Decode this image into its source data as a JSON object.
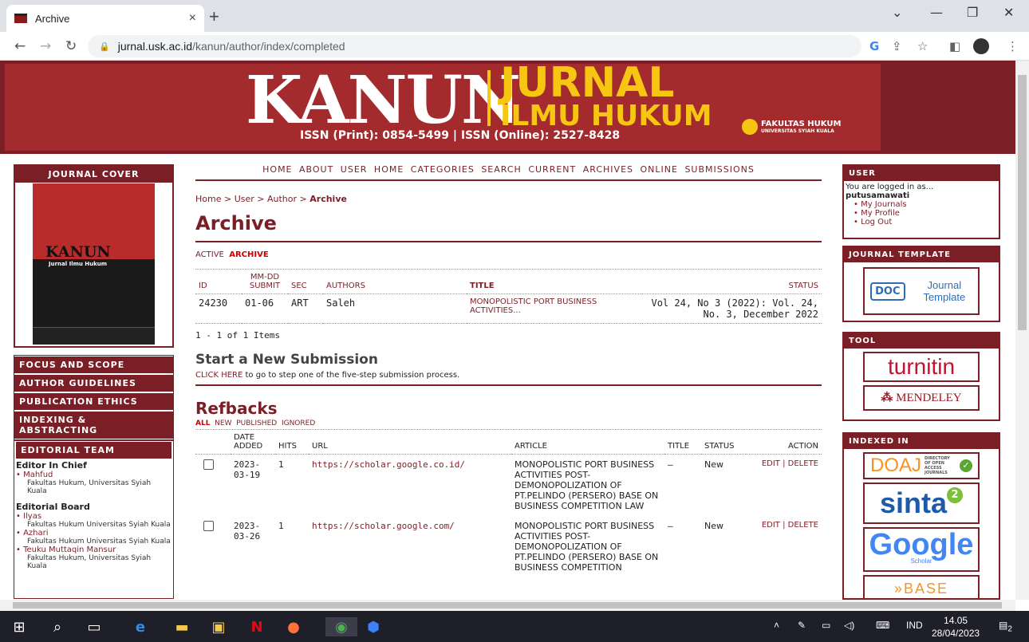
{
  "browser": {
    "tab_title": "Archive",
    "tab_close": "×",
    "new_tab": "+",
    "url_host": "jurnal.usk.ac.id",
    "url_path": "/kanun/author/index/completed",
    "win_min": "—",
    "win_max": "❐",
    "win_close": "✕",
    "win_tabs": "⌄"
  },
  "banner": {
    "kanun": "KANUN",
    "jurnal": "JURNAL",
    "ilmu": "ILMU HUKUM",
    "issn": "ISSN (Print): 0854-5499 | ISSN (Online): 2527-8428",
    "faculty": "FAKULTAS HUKUM",
    "university": "UNIVERSITAS SYIAH KUALA"
  },
  "left": {
    "cover_title": "JOURNAL COVER",
    "cover_kanun": "KANUN",
    "cover_sub": "Jurnal Ilmu Hukum",
    "menu": [
      "FOCUS AND SCOPE",
      "AUTHOR GUIDELINES",
      "PUBLICATION ETHICS",
      "INDEXING & ABSTRACTING"
    ],
    "team_title": "EDITORIAL TEAM",
    "chief_heading": "Editor In Chief",
    "chief_name": "• Mahfud",
    "chief_aff": "Fakultas Hukum, Universitas Syiah Kuala",
    "board_heading": "Editorial Board",
    "board": [
      {
        "name": "• Ilyas",
        "aff": "Fakultas Hukum Universitas Syiah Kuala"
      },
      {
        "name": "• Azhari",
        "aff": "Fakultas Hukum Universitas Syiah Kuala"
      },
      {
        "name": "• Teuku Muttaqin Mansur",
        "aff": "Fakultas Hukum, Universitas Syiah Kuala"
      }
    ]
  },
  "main": {
    "nav": "HOME  ABOUT  USER HOME  CATEGORIES  SEARCH  CURRENT  ARCHIVES  ONLINE SUBMISSIONS",
    "crumb_home": "Home",
    "crumb_user": "User",
    "crumb_author": "Author",
    "crumb_current": "Archive",
    "sep": " > ",
    "title": "Archive",
    "sub_active": "ACTIVE",
    "sub_archive": "ARCHIVE",
    "archive_headers": {
      "id": "ID",
      "submit_a": "MM-DD",
      "submit_b": "SUBMIT",
      "sec": "SEC",
      "authors": "AUTHORS",
      "title": "TITLE",
      "status": "STATUS"
    },
    "archive_row": {
      "id": "24230",
      "submit": "01-06",
      "sec": "ART",
      "authors": "Saleh",
      "title": "MONOPOLISTIC PORT BUSINESS ACTIVITIES...",
      "status": "Vol 24, No 3 (2022): Vol. 24, No. 3, December 2022"
    },
    "pager": "1 - 1 of 1 Items",
    "new_sub_title": "Start a New Submission",
    "click_here": "CLICK HERE",
    "new_sub_text": " to go to step one of the five-step submission process.",
    "refbacks_title": "Refbacks",
    "rf_all": "ALL",
    "rf_new": "NEW",
    "rf_published": "PUBLISHED",
    "rf_ignored": "IGNORED",
    "rf_headers": {
      "date_a": "DATE",
      "date_b": "ADDED",
      "hits": "HITS",
      "url": "URL",
      "article": "ARTICLE",
      "title": "TITLE",
      "status": "STATUS",
      "action": "ACTION"
    },
    "refbacks": [
      {
        "date": "2023-03-19",
        "hits": "1",
        "url": "https://scholar.google.co.id/",
        "article": "MONOPOLISTIC PORT BUSINESS ACTIVITIES POST-DEMONOPOLIZATION OF PT.PELINDO (PERSERO) BASE ON BUSINESS COMPETITION LAW",
        "title": "—",
        "status": "New",
        "edit": "EDIT",
        "delete": "DELETE"
      },
      {
        "date": "2023-03-26",
        "hits": "1",
        "url": "https://scholar.google.com/",
        "article": "MONOPOLISTIC PORT BUSINESS ACTIVITIES POST-DEMONOPOLIZATION OF PT.PELINDO (PERSERO) BASE ON BUSINESS COMPETITION",
        "title": "—",
        "status": "New",
        "edit": "EDIT",
        "delete": "DELETE"
      }
    ]
  },
  "right": {
    "user_title": "USER",
    "logged": "You are logged in as...",
    "username": "putusamawati",
    "links": [
      "My Journals",
      "My Profile",
      "Log Out"
    ],
    "template_title": "JOURNAL TEMPLATE",
    "doc": "DOC",
    "journal_template": "Journal Template",
    "tool_title": "TOOL",
    "turnitin": "turnitin",
    "mendeley": "MENDELEY",
    "indexed_title": "INDEXED IN",
    "doaj": "DOAJ",
    "doaj_sub": "DIRECTORY OF OPEN ACCESS JOURNALS",
    "sinta": "sinta",
    "google": "Google",
    "scholar": "Scholar",
    "base": "BASE"
  },
  "taskbar": {
    "lang": "IND",
    "time": "14.05",
    "date": "28/04/2023",
    "notif": "2"
  }
}
